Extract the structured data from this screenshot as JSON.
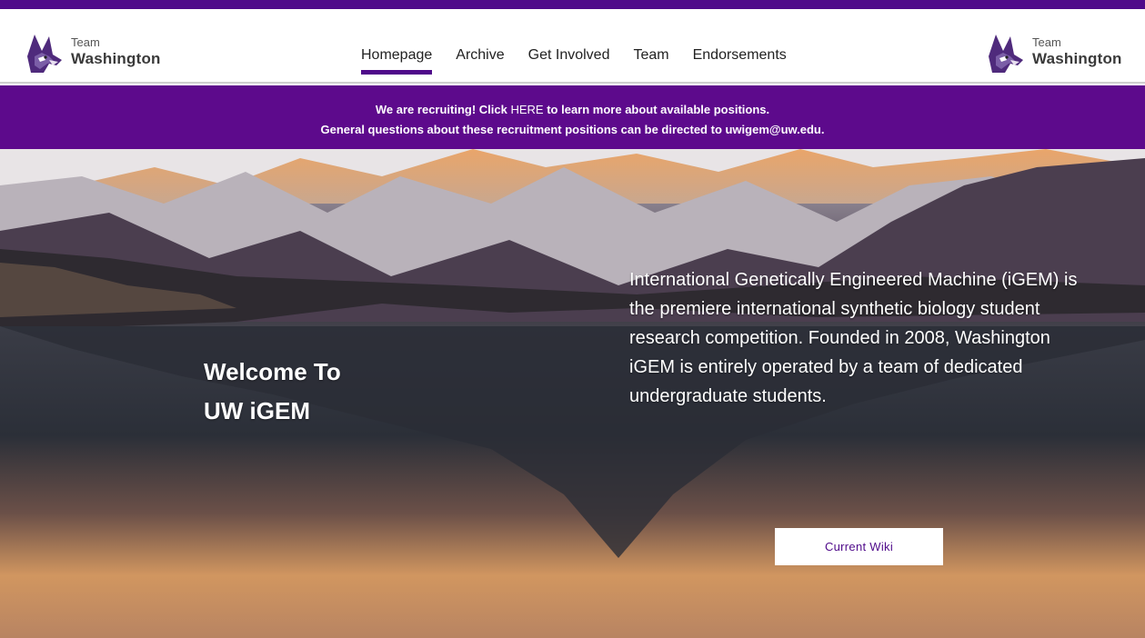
{
  "brand": {
    "small": "Team",
    "big": "Washington"
  },
  "nav": {
    "items": [
      {
        "label": "Homepage",
        "active": true
      },
      {
        "label": "Archive",
        "active": false
      },
      {
        "label": "Get Involved",
        "active": false
      },
      {
        "label": "Team",
        "active": false
      },
      {
        "label": "Endorsements",
        "active": false
      }
    ]
  },
  "banner": {
    "line1_pre": "We are recruiting! Click ",
    "line1_link": "HERE",
    "line1_post": " to learn more about available positions.",
    "line2": "General questions about these recruitment positions can be directed to uwigem@uw.edu."
  },
  "hero": {
    "welcome_line1": "Welcome To",
    "welcome_line2": "UW iGEM",
    "intro": "International Genetically Engineered Machine (iGEM) is the premiere international synthetic biology student research competition. Founded in 2008, Washington iGEM is entirely operated by a team of dedicated undergraduate students.",
    "button_label": "Current Wiki"
  },
  "colors": {
    "purple": "#5d0a8c",
    "accent": "#4f0a8a"
  },
  "icons": {
    "logo": "husky-logo-icon"
  }
}
